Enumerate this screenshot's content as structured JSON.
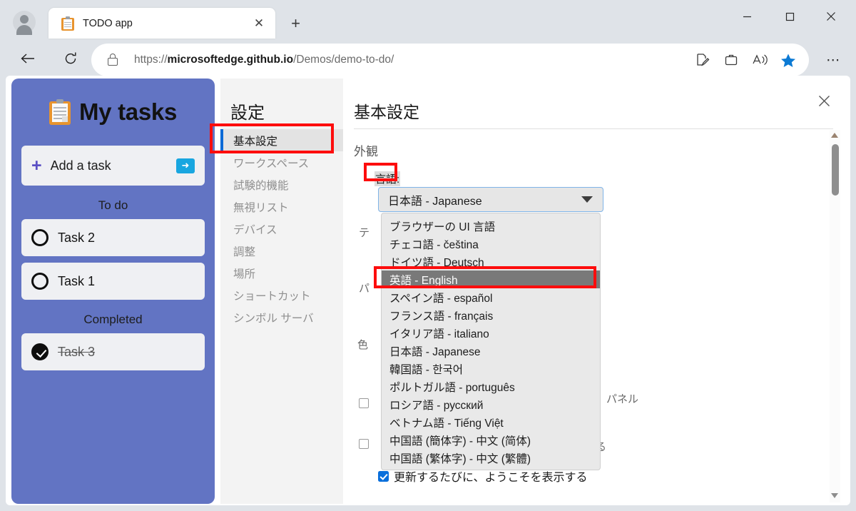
{
  "browser": {
    "tab": {
      "title": "TODO app",
      "favicon": "clipboard-icon",
      "close_label": "✕"
    },
    "new_tab_label": "+",
    "window_controls": {
      "minimize": "–",
      "maximize": "☐",
      "close": "✕"
    },
    "nav": {
      "back": "←",
      "reload": "⟳"
    },
    "address": {
      "scheme": "https://",
      "host": "microsoftedge.github.io",
      "path": "/Demos/demo-to-do/",
      "lock": "lock-icon"
    },
    "toolbar_icons": [
      "read-aloud-icon",
      "collections-icon",
      "immersive-reader-icon",
      "favorites-star-icon"
    ],
    "more_label": "⋯"
  },
  "todo_app": {
    "title": "My tasks",
    "icon": "clipboard-emoji",
    "add_task": {
      "plus": "+",
      "placeholder": "Add a task",
      "submit": "➜"
    },
    "sections": [
      {
        "label": "To do",
        "tasks": [
          {
            "name": "Task 2",
            "completed": false
          },
          {
            "name": "Task 1",
            "completed": false
          }
        ]
      },
      {
        "label": "Completed",
        "tasks": [
          {
            "name": "Task 3",
            "completed": true
          }
        ]
      }
    ]
  },
  "settings": {
    "nav_title": "設定",
    "nav_items": [
      {
        "label": "基本設定",
        "active": true
      },
      {
        "label": "ワークスペース",
        "active": false
      },
      {
        "label": "試験的機能",
        "active": false
      },
      {
        "label": "無視リスト",
        "active": false
      },
      {
        "label": "デバイス",
        "active": false
      },
      {
        "label": "調整",
        "active": false
      },
      {
        "label": "場所",
        "active": false
      },
      {
        "label": "ショートカット",
        "active": false
      },
      {
        "label": "シンボル サーバ",
        "active": false
      }
    ],
    "page_title": "基本設定",
    "section_heading": "外観",
    "language_label": "言語:",
    "language_select_value": "日本語 - Japanese",
    "language_options": [
      {
        "label": "ブラウザーの UI 言語",
        "selected": false
      },
      {
        "label": "チェコ語 - čeština",
        "selected": false
      },
      {
        "label": "ドイツ語 - Deutsch",
        "selected": false
      },
      {
        "label": "英語 - English",
        "selected": true
      },
      {
        "label": "スペイン語 - español",
        "selected": false
      },
      {
        "label": "フランス語 - français",
        "selected": false
      },
      {
        "label": "イタリア語 - italiano",
        "selected": false
      },
      {
        "label": "日本語 - Japanese",
        "selected": false
      },
      {
        "label": "韓国語 - 한국어",
        "selected": false
      },
      {
        "label": "ポルトガル語 - português",
        "selected": false
      },
      {
        "label": "ロシア語 - русский",
        "selected": false
      },
      {
        "label": "ベトナム語 - Tiếng Việt",
        "selected": false
      },
      {
        "label": "中国語 (簡体字) - 中文 (简体)",
        "selected": false
      },
      {
        "label": "中国語 (繁体字) - 中文 (繁體)",
        "selected": false
      }
    ],
    "occluded_labels": {
      "theme": "テ",
      "panel_left": "パ",
      "color": "色",
      "panel_right": "、パネル",
      "suffix_ru": "る"
    },
    "welcome_checkbox": {
      "label": "更新するたびに、ようこそを表示する",
      "checked": true
    },
    "close_label": "✕",
    "scrollbar": {
      "up": "scroll-up-arrow",
      "down": "scroll-down-arrow"
    }
  },
  "annotations": {
    "color": "#fd0d0d",
    "boxes": [
      "nav-item-basic-settings",
      "language-label",
      "dropdown-option-english"
    ]
  }
}
